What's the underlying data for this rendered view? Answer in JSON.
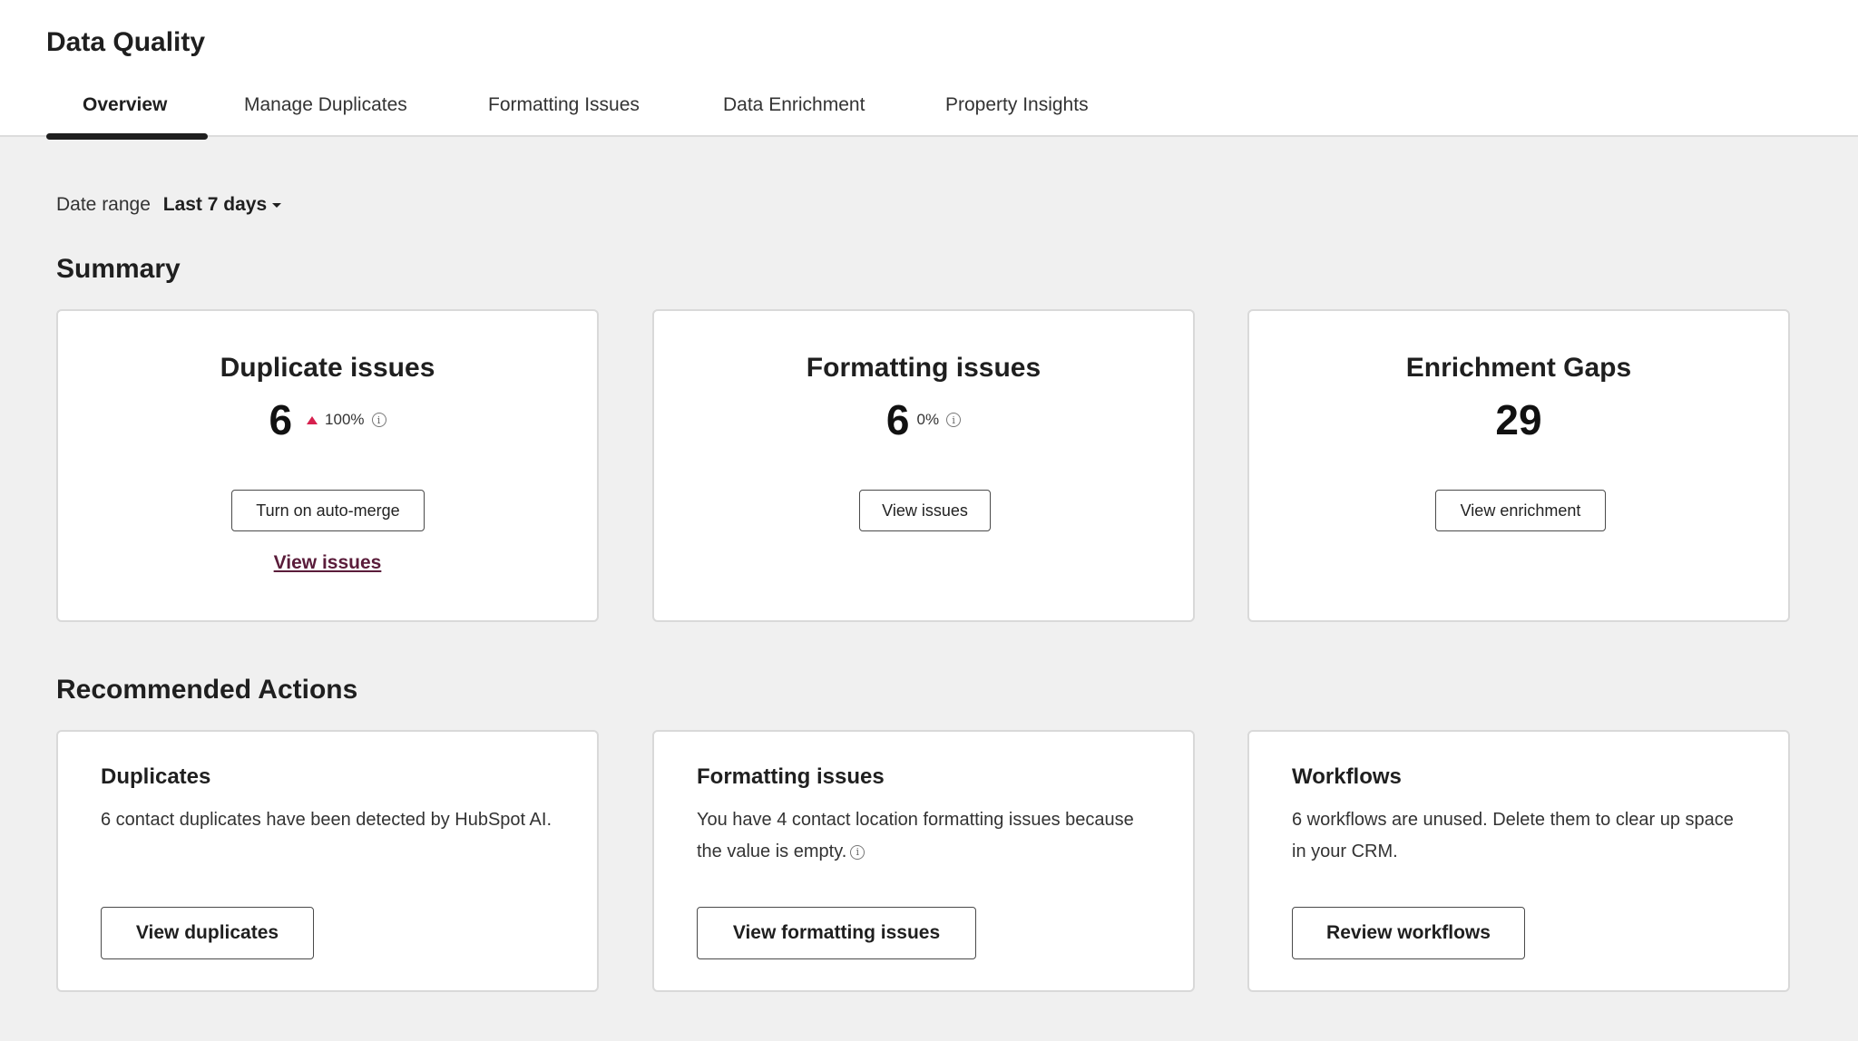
{
  "header": {
    "title": "Data Quality",
    "tabs": [
      {
        "label": "Overview",
        "active": true
      },
      {
        "label": "Manage Duplicates",
        "active": false
      },
      {
        "label": "Formatting Issues",
        "active": false
      },
      {
        "label": "Data Enrichment",
        "active": false
      },
      {
        "label": "Property Insights",
        "active": false
      }
    ]
  },
  "filters": {
    "date_range_label": "Date range",
    "date_range_value": "Last 7 days"
  },
  "summary": {
    "title": "Summary",
    "cards": [
      {
        "title": "Duplicate issues",
        "value": "6",
        "change": "100%",
        "trend": "up",
        "trend_color": "#d6204e",
        "button": "Turn on auto-merge",
        "link": "View issues"
      },
      {
        "title": "Formatting issues",
        "value": "6",
        "change": "0%",
        "button": "View issues"
      },
      {
        "title": "Enrichment Gaps",
        "value": "29",
        "button": "View enrichment"
      }
    ]
  },
  "recommended": {
    "title": "Recommended Actions",
    "cards": [
      {
        "title": "Duplicates",
        "description": "6 contact duplicates have been detected by HubSpot AI.",
        "button": "View duplicates"
      },
      {
        "title": "Formatting issues",
        "description": "You have 4 contact location formatting issues because the value is empty.",
        "button": "View formatting issues"
      },
      {
        "title": "Workflows",
        "description": "6 workflows are unused. Delete them to clear up space in your CRM.",
        "button": "Review workflows"
      }
    ]
  },
  "colors": {
    "background": "#f0f0f0",
    "card": "#ffffff",
    "link": "#5a1c3a",
    "tab_indicator": "#1f1f1f"
  }
}
